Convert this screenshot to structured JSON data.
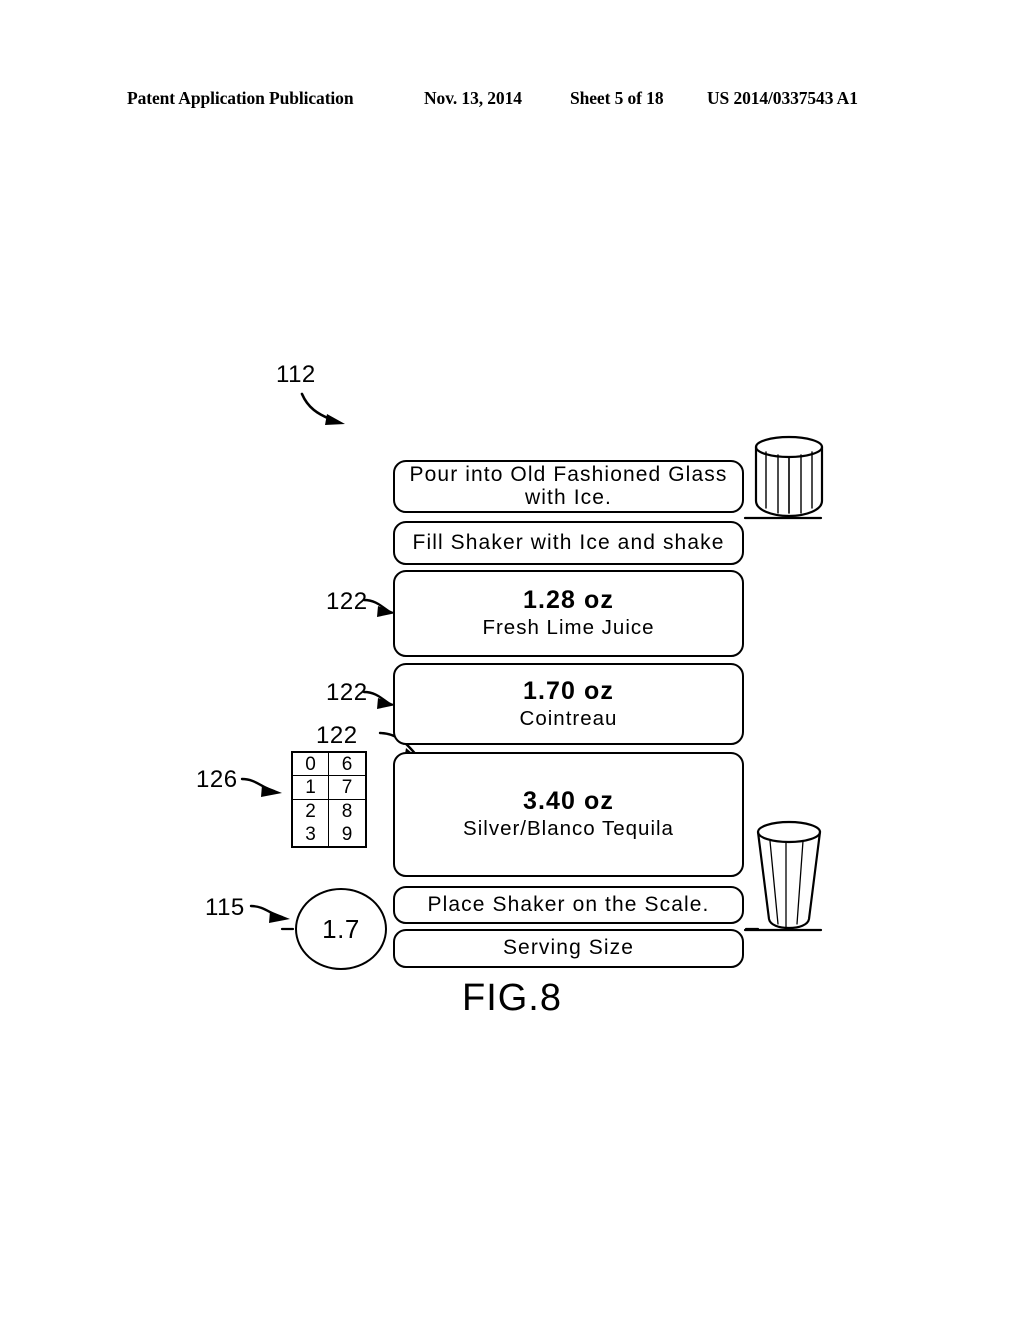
{
  "header": {
    "publication": "Patent Application Publication",
    "date": "Nov. 13, 2014",
    "sheet": "Sheet 5 of 18",
    "number": "US 2014/0337543 A1"
  },
  "figure": {
    "caption": "FIG.8",
    "reference_numerals": {
      "device": "112",
      "ingredient_row_a": "122",
      "ingredient_row_b": "122",
      "ingredient_row_c": "122",
      "keypad": "126",
      "serving_size_bubble": "115"
    }
  },
  "screen": {
    "rows": [
      {
        "id": "pour",
        "type": "instruction",
        "text": "Pour into Old Fashioned Glass with Ice.",
        "icon": ""
      },
      {
        "id": "fill",
        "type": "instruction",
        "text": "Fill Shaker with Ice and shake",
        "icon": "shake-icon"
      },
      {
        "id": "ing-0",
        "type": "ingredient",
        "amount": "1.28 oz",
        "name": "Fresh Lime Juice",
        "icon": "lime-wheel-icon"
      },
      {
        "id": "ing-1",
        "type": "ingredient",
        "amount": "1.70 oz",
        "name": "Cointreau",
        "icon": ""
      },
      {
        "id": "ing-2",
        "type": "ingredient",
        "amount": "3.40 oz",
        "name": "Silver/Blanco Tequila",
        "icon": ""
      },
      {
        "id": "place",
        "type": "instruction",
        "text": "Place Shaker on the Scale.",
        "icon": ""
      },
      {
        "id": "serving",
        "type": "label",
        "text": "Serving Size",
        "icon": ""
      }
    ]
  },
  "keypad": {
    "keys": [
      "0",
      "6",
      "1",
      "7",
      "2",
      "8",
      "3",
      "9"
    ]
  },
  "serving_size": {
    "value": "1.7"
  },
  "glassware": {
    "old_fashioned_glass": "old-fashioned-glass-icon",
    "shaker_tin": "shaker-tin-icon"
  },
  "colors": {
    "ink": "#000000",
    "paper": "#ffffff"
  }
}
